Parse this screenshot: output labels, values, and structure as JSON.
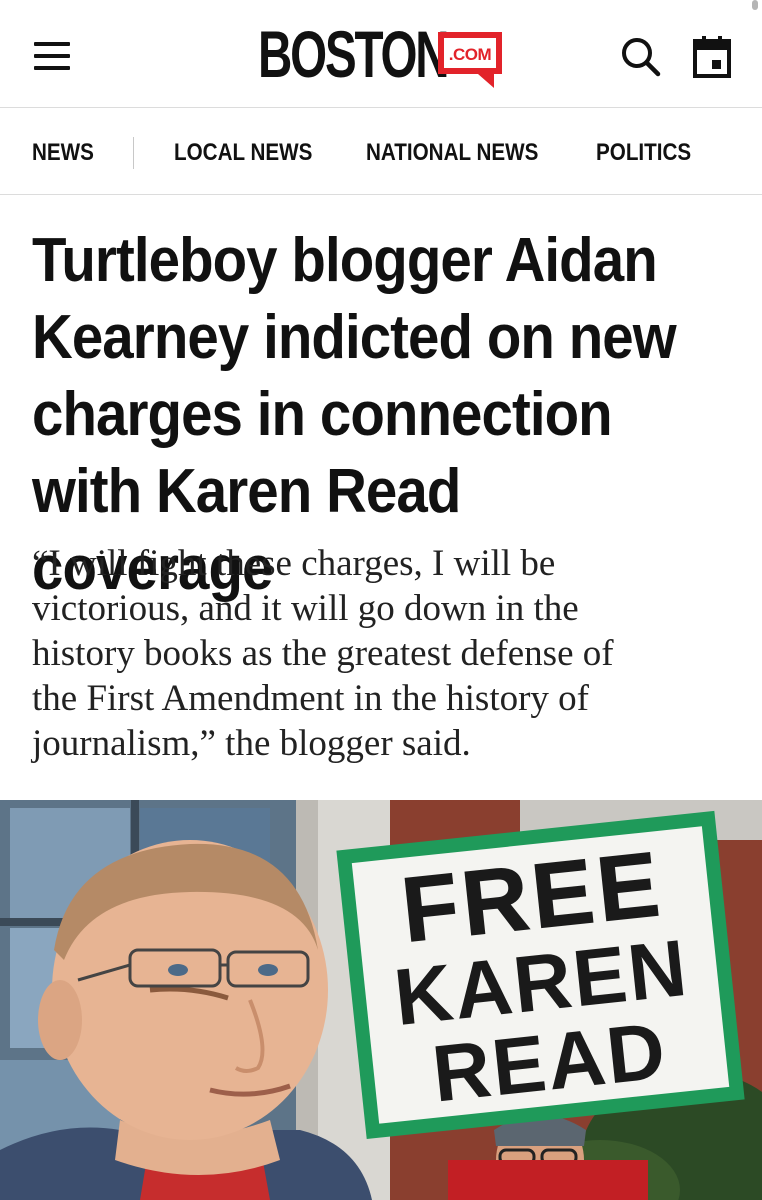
{
  "header": {
    "logo_text": "BOSTON",
    "logo_badge": ".COM",
    "brand_color": "#e2232a",
    "icons": [
      "menu-icon",
      "search-icon",
      "calendar-icon"
    ]
  },
  "nav": {
    "items": [
      {
        "label": "NEWS"
      },
      {
        "label": "LOCAL NEWS"
      },
      {
        "label": "NATIONAL NEWS"
      },
      {
        "label": "POLITICS"
      }
    ]
  },
  "article": {
    "headline_lines": [
      "Turtleboy blogger Aidan",
      "Kearney indicted on new",
      "charges in connection",
      "with Karen Read coverage"
    ],
    "deck_lines": [
      "“I will fight these charges, I will be",
      "victorious, and it will go down in the",
      "history books as the greatest defense of",
      "the First Amendment in the history of",
      "journalism,” the blogger said."
    ]
  },
  "photo": {
    "sign_lines": [
      "FREE",
      "KAREN",
      "READ"
    ],
    "sign_border_color": "#1f9a5a"
  }
}
